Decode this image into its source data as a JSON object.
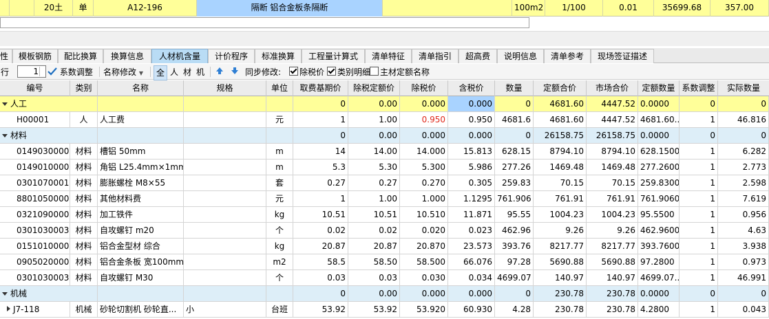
{
  "top_row": {
    "qty_code": "20土",
    "unit_type": "单",
    "code": "A12-196",
    "name": "隔断 铝合金板条隔断",
    "unit": "100m2",
    "ratio": "1/100",
    "quantity": "0.01",
    "unit_price": "35699.68",
    "total": "357.00"
  },
  "tabs": [
    "模板钢筋",
    "配比换算",
    "换算信息",
    "人材机含量",
    "计价程序",
    "标准换算",
    "工程量计算式",
    "清单特征",
    "清单指引",
    "超高费",
    "说明信息",
    "清单参考",
    "现场签证描述"
  ],
  "active_tab": 3,
  "toolbar": {
    "row_label": "行",
    "row_value": "1",
    "coef_adjust": "系数调整",
    "name_modify": "名称修改",
    "filter_all": "全",
    "filter_labor": "人",
    "filter_material": "材",
    "filter_machine": "机",
    "sync_label": "同步修改:",
    "tax_label": "除税价",
    "detail_label": "类别明细",
    "main_name_label": "主材定额名称"
  },
  "columns": [
    "编号",
    "类别",
    "名称",
    "规格",
    "单位",
    "取费基期价",
    "除税定额价",
    "除税价",
    "含税价",
    "数量",
    "定额合价",
    "市场合价",
    "定额数量",
    "系数调整",
    "实际数量"
  ],
  "rows": [
    {
      "kind": "group",
      "style": "yellow",
      "label": "人工",
      "vals": [
        "",
        "",
        "",
        "",
        "",
        "0",
        "0.00",
        "0.000",
        "0.000",
        "0",
        "4681.60",
        "4447.52",
        "0.0000",
        "0",
        "0"
      ]
    },
    {
      "kind": "item",
      "vals": [
        "H00001",
        "人",
        "人工费",
        "",
        "元",
        "1",
        "1.00",
        "0.950",
        "0.950",
        "4681.6",
        "4681.60",
        "4447.52",
        "4681.60...",
        "1",
        "46.816"
      ]
    },
    {
      "kind": "group",
      "style": "blue",
      "label": "材料",
      "vals": [
        "",
        "",
        "",
        "",
        "",
        "0",
        "0.00",
        "0.000",
        "0.000",
        "0",
        "26158.75",
        "26158.75",
        "0.0000",
        "0",
        "0"
      ]
    },
    {
      "kind": "item",
      "vals": [
        "01490300001",
        "材料",
        "槽铝 50mm",
        "",
        "m",
        "14",
        "14.00",
        "14.000",
        "15.813",
        "628.15",
        "8794.10",
        "8794.10",
        "628.1500",
        "1",
        "6.282"
      ]
    },
    {
      "kind": "item",
      "vals": [
        "01490100002",
        "材料",
        "角铝 L25.4mm×1mm",
        "",
        "m",
        "5.3",
        "5.30",
        "5.300",
        "5.986",
        "277.26",
        "1469.48",
        "1469.48",
        "277.2600",
        "1",
        "2.773"
      ]
    },
    {
      "kind": "item",
      "vals": [
        "03010700012",
        "材料",
        "膨胀螺栓 M8×55",
        "",
        "套",
        "0.27",
        "0.27",
        "0.270",
        "0.305",
        "259.83",
        "70.15",
        "70.15",
        "259.8300",
        "1",
        "2.598"
      ]
    },
    {
      "kind": "item",
      "vals": [
        "88010500001",
        "材料",
        "其他材料费",
        "",
        "元",
        "1",
        "1.00",
        "1.000",
        "1.1295",
        "761.906",
        "761.91",
        "761.91",
        "761.9060",
        "1",
        "7.619"
      ]
    },
    {
      "kind": "item",
      "vals": [
        "03210900009",
        "材料",
        "加工铁件",
        "",
        "kg",
        "10.51",
        "10.51",
        "10.510",
        "11.871",
        "95.55",
        "1004.23",
        "1004.23",
        "95.5500",
        "1",
        "0.956"
      ]
    },
    {
      "kind": "item",
      "vals": [
        "03010300031",
        "材料",
        "自攻螺钉 m20",
        "",
        "个",
        "0.02",
        "0.02",
        "0.020",
        "0.023",
        "462.96",
        "9.26",
        "9.26",
        "462.9600",
        "1",
        "4.63"
      ]
    },
    {
      "kind": "item",
      "vals": [
        "01510100001",
        "材料",
        "铝合金型材 综合",
        "",
        "kg",
        "20.87",
        "20.87",
        "20.870",
        "23.573",
        "393.76",
        "8217.77",
        "8217.77",
        "393.7600",
        "1",
        "3.938"
      ]
    },
    {
      "kind": "item",
      "vals": [
        "09050200007",
        "材料",
        "铝合金条板 宽100mm",
        "",
        "m2",
        "58.5",
        "58.50",
        "58.500",
        "66.076",
        "97.28",
        "5690.88",
        "5690.88",
        "97.2800",
        "1",
        "0.973"
      ]
    },
    {
      "kind": "item",
      "vals": [
        "03010300033",
        "材料",
        "自攻螺钉 M30",
        "",
        "个",
        "0.03",
        "0.03",
        "0.030",
        "0.034",
        "4699.07",
        "140.97",
        "140.97",
        "4699.07...",
        "1",
        "46.991"
      ]
    },
    {
      "kind": "group",
      "style": "blue",
      "label": "机械",
      "vals": [
        "",
        "",
        "",
        "",
        "",
        "0",
        "0.00",
        "0.000",
        "0.000",
        "0",
        "230.78",
        "230.78",
        "0.0000",
        "0",
        "0"
      ]
    },
    {
      "kind": "item",
      "expand": true,
      "vals": [
        "J7-118",
        "机械",
        "砂轮切割机 砂轮直...",
        "小",
        "台班",
        "53.92",
        "53.92",
        "53.920",
        "60.930",
        "4.28",
        "230.78",
        "230.78",
        "4.2800",
        "1",
        "0.043"
      ]
    }
  ],
  "colors": {
    "group_yellow": "#ffff99",
    "group_blue": "#ddeef8",
    "active_tab": "#b9dcf5",
    "selection": "#a9d3ff",
    "changed_value": "#e0281a"
  }
}
